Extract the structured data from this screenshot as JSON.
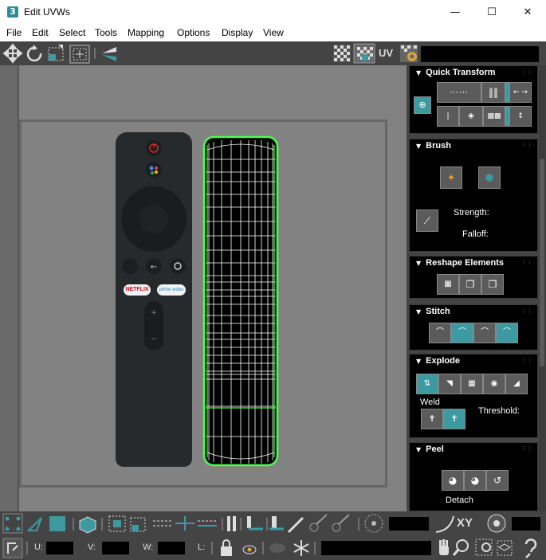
{
  "window": {
    "app_icon": "3",
    "title": "Edit UVWs",
    "min_icon": "minimize-icon",
    "max_icon": "maximize-icon",
    "close_icon": "close-icon"
  },
  "menu": [
    "File",
    "Edit",
    "Select",
    "Tools",
    "Mapping",
    "Options",
    "Display",
    "View"
  ],
  "toolbar": {
    "uv_label": "UV",
    "icons": [
      "move-icon",
      "rotate-icon",
      "scale-icon",
      "freeform-icon",
      "mirror-icon",
      "checker-pattern-icon",
      "checker-toggle-icon",
      "settings-icon"
    ]
  },
  "viewport": {
    "remote_netflix": "NETFLIX",
    "remote_prime": "prime video"
  },
  "panel": {
    "quick_transform": {
      "title": "Quick Transform"
    },
    "brush": {
      "title": "Brush",
      "strength_label": "Strength:",
      "falloff_label": "Falloff:"
    },
    "reshape": {
      "title": "Reshape Elements"
    },
    "stitch": {
      "title": "Stitch"
    },
    "explode": {
      "title": "Explode",
      "weld_label": "Weld",
      "threshold_label": "Threshold:"
    },
    "peel": {
      "title": "Peel",
      "detach_label": "Detach"
    }
  },
  "bottom": {
    "xy_label": "XY",
    "u_label": "U:",
    "v_label": "V:",
    "w_label": "W:",
    "l_label": "L:"
  },
  "colors": {
    "accent": "#3d9aa1",
    "panel_bg": "#444444",
    "uv_outline": "#4cff4c"
  }
}
